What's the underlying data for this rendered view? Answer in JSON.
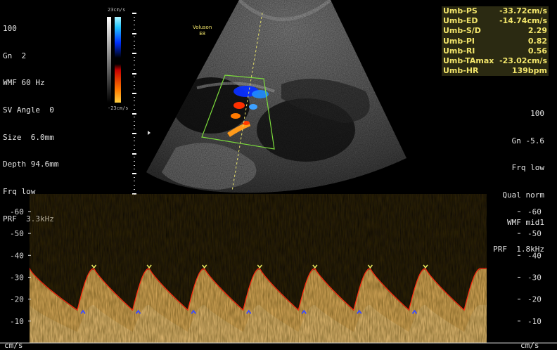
{
  "top_bar": {
    "left": "~ ~",
    "center": "~ / ~ / ~",
    "right": "~ ~"
  },
  "left_params": [
    "100",
    "Gn  2",
    "WMF 60 Hz",
    "SV Angle  0",
    "Size  6.0mm",
    "Depth 94.6mm",
    "Frq low",
    "PRF  3.3kHz"
  ],
  "color_bar": {
    "top_label": "23cm/s",
    "bottom_label": "-23cm/s"
  },
  "probe_label": [
    "Voluson",
    "E8"
  ],
  "measurements": [
    {
      "label": "Umb-PS",
      "value": "-33.72cm/s"
    },
    {
      "label": "Umb-ED",
      "value": "-14.74cm/s"
    },
    {
      "label": "Umb-S/D",
      "value": "2.29"
    },
    {
      "label": "Umb-PI",
      "value": "0.82"
    },
    {
      "label": "Umb-RI",
      "value": "0.56"
    },
    {
      "label": "Umb-TAmax",
      "value": "-23.02cm/s"
    },
    {
      "label": "Umb-HR",
      "value": "139bpm"
    }
  ],
  "right_params": [
    "100",
    "Gn -5.6",
    "Frq low",
    "Qual norm",
    "WMF mid1",
    "PRF  1.8kHz"
  ],
  "doppler": {
    "scale_labels": [
      "-60",
      "-50",
      "-40",
      "-30",
      "-20",
      "-10"
    ],
    "unit": "cm/s",
    "scale_min": 0,
    "scale_max": -68,
    "cycles": 7,
    "peak_velocity": -33.7,
    "end_diastolic_velocity": -14.7,
    "trace_color": "#e0b060",
    "envelope_color": "#ff2a10",
    "peak_marker_color": "#e8e860",
    "ed_marker_color": "#3b4cff"
  }
}
